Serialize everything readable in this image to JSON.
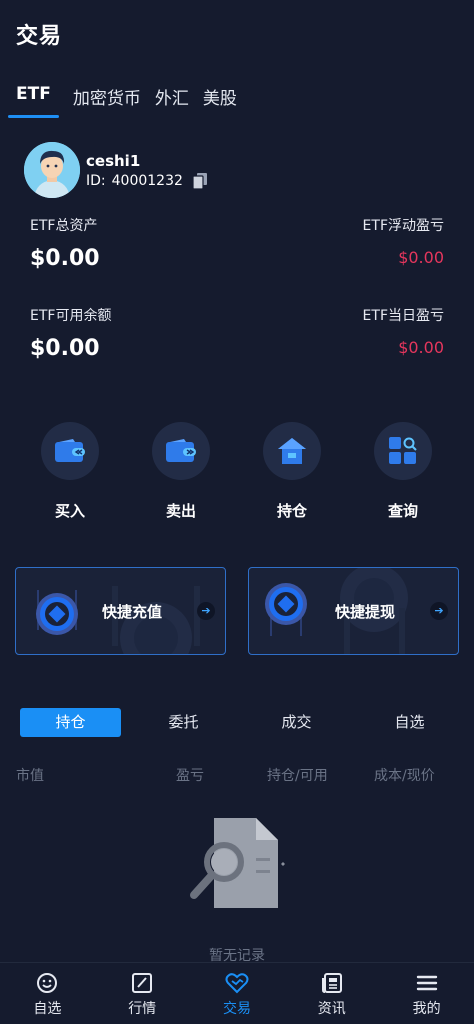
{
  "header": {
    "title": "交易"
  },
  "top_tabs": [
    {
      "label": "ETF",
      "active": true
    },
    {
      "label": "加密货币"
    },
    {
      "label": "外汇"
    },
    {
      "label": "美股"
    }
  ],
  "user": {
    "name": "ceshi1",
    "id_label": "ID:",
    "id_value": "40001232"
  },
  "stats": {
    "total_assets_label": "ETF总资产",
    "total_assets_value": "$0.00",
    "floating_pnl_label": "ETF浮动盈亏",
    "floating_pnl_value": "$0.00",
    "available_label": "ETF可用余额",
    "available_value": "$0.00",
    "daily_pnl_label": "ETF当日盈亏",
    "daily_pnl_value": "$0.00"
  },
  "actions": [
    {
      "label": "买入",
      "icon": "wallet-in-icon"
    },
    {
      "label": "卖出",
      "icon": "wallet-out-icon"
    },
    {
      "label": "持仓",
      "icon": "house-icon"
    },
    {
      "label": "查询",
      "icon": "grid-search-icon"
    }
  ],
  "quick": {
    "deposit_label": "快捷充值",
    "withdraw_label": "快捷提现",
    "arrow": "➔"
  },
  "sub_tabs": [
    {
      "label": "持仓",
      "active": true
    },
    {
      "label": "委托"
    },
    {
      "label": "成交"
    },
    {
      "label": "自选"
    }
  ],
  "columns": [
    "市值",
    "盈亏",
    "持仓/可用",
    "成本/现价"
  ],
  "empty_text": "暂无记录",
  "bottom_nav": [
    {
      "label": "自选",
      "icon": "smile-icon"
    },
    {
      "label": "行情",
      "icon": "chart-icon"
    },
    {
      "label": "交易",
      "icon": "trade-icon",
      "active": true
    },
    {
      "label": "资讯",
      "icon": "news-icon"
    },
    {
      "label": "我的",
      "icon": "menu-icon"
    }
  ],
  "colors": {
    "background": "#151b2e",
    "accent": "#1a8ff5",
    "loss_red": "#e5365d",
    "muted_text": "#6a7386"
  }
}
